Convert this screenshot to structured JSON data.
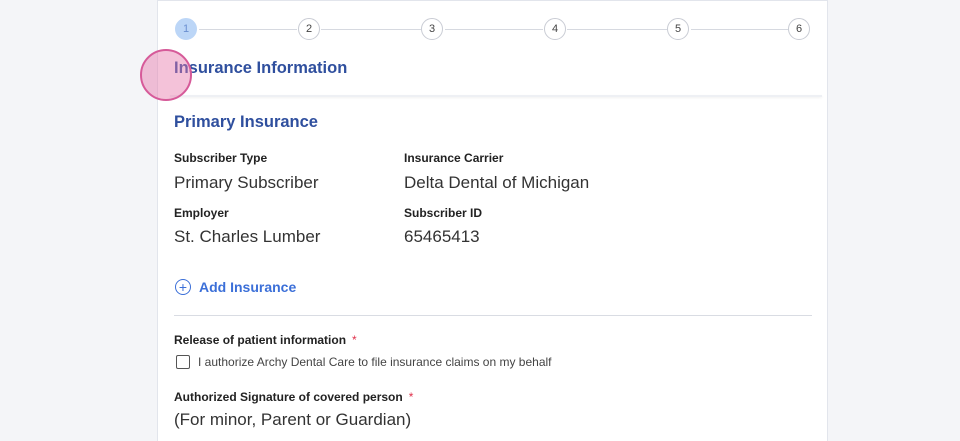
{
  "stepper": {
    "steps": [
      "1",
      "2",
      "3",
      "4",
      "5",
      "6"
    ],
    "active_step": 1
  },
  "section": {
    "title": "Insurance Information"
  },
  "primary": {
    "title": "Primary Insurance",
    "subscriber_type_label": "Subscriber Type",
    "subscriber_type_value": "Primary Subscriber",
    "carrier_label": "Insurance Carrier",
    "carrier_value": "Delta Dental of Michigan",
    "employer_label": "Employer",
    "employer_value": "St. Charles Lumber",
    "subscriber_id_label": "Subscriber ID",
    "subscriber_id_value": "65465413"
  },
  "add_insurance": {
    "label": "Add Insurance",
    "icon": "plus-circle-icon"
  },
  "release": {
    "label": "Release of patient information",
    "required_mark": "*",
    "checkbox_label": "I authorize Archy Dental Care to file insurance claims on my behalf",
    "checked": false
  },
  "signature": {
    "label": "Authorized Signature of covered person",
    "required_mark": "*",
    "value": "(For minor, Parent or Guardian)"
  },
  "colors": {
    "accent": "#2f4f9e",
    "link": "#3b6fd8",
    "required": "#e0314b",
    "active_step": "#bcd6f7"
  }
}
